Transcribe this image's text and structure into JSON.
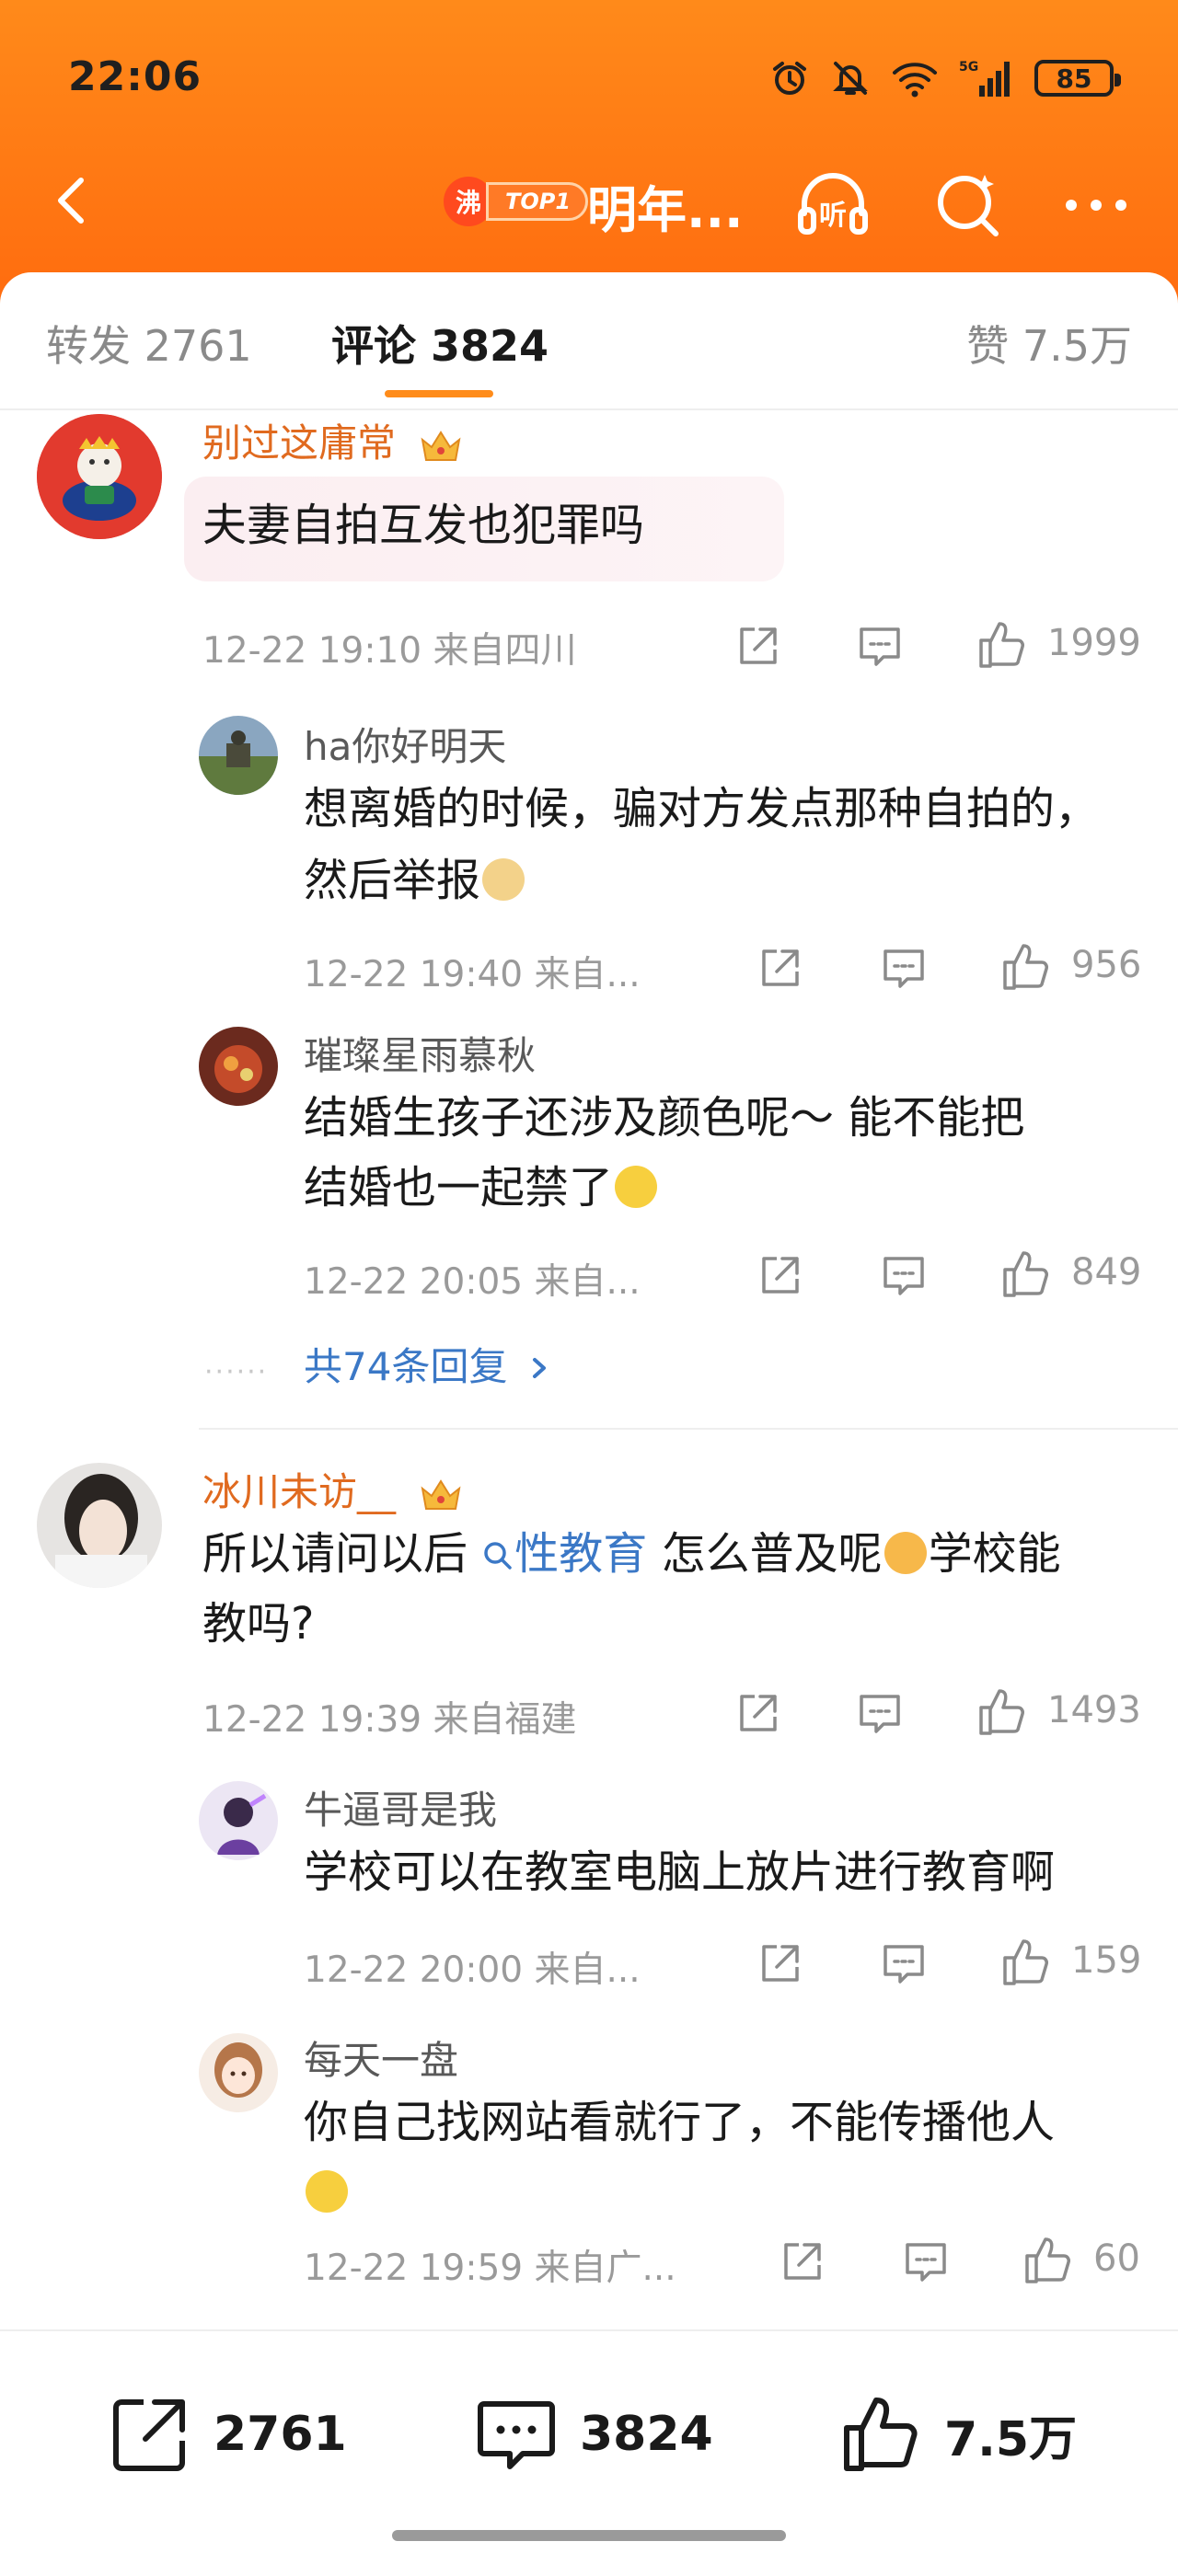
{
  "status_bar": {
    "time": "22:06",
    "battery": "85",
    "icons": [
      "alarm-icon",
      "mute-icon",
      "wifi-icon",
      "signal-5g-icon"
    ]
  },
  "header": {
    "badge_fei": "沸",
    "badge_top": "TOP1",
    "title": "明年...",
    "icons": [
      "back-icon",
      "listen-icon",
      "search-icon",
      "more-icon"
    ]
  },
  "tabs": {
    "repost": "转发 2761",
    "comment": "评论 3824",
    "like": "赞 7.5万"
  },
  "comments": [
    {
      "username": "别过这庸常",
      "text": "夫妻自拍互发也犯罪吗",
      "meta": "12-22 19:10 来自四川",
      "likes": "1999",
      "replies": [
        {
          "username": "ha你好明天",
          "text_line1": "想离婚的时候，骗对方发点那种自拍的，",
          "text_line2": "然后举报",
          "meta": "12-22 19:40 来自...",
          "likes": "956"
        },
        {
          "username": "璀璨星雨慕秋",
          "text_line1": "结婚生孩子还涉及颜色呢～ 能不能把",
          "text_line2": "结婚也一起禁了",
          "meta": "12-22 20:05 来自...",
          "likes": "849"
        }
      ],
      "more_replies": "共74条回复"
    },
    {
      "username": "冰川未访__",
      "text_prefix": "所以请问以后",
      "topic": "性教育",
      "text_mid": "怎么普及呢",
      "text_suffix": "学校能",
      "text_line2": "教吗?",
      "meta": "12-22 19:39 来自福建",
      "likes": "1493",
      "replies": [
        {
          "username": "牛逼哥是我",
          "text_line1": "学校可以在教室电脑上放片进行教育啊",
          "meta": "12-22 20:00 来自...",
          "likes": "159"
        },
        {
          "username": "每天一盘",
          "text_line1": "你自己找网站看就行了，不能传播他人",
          "meta": "12-22 19:59 来自广...",
          "likes": "60"
        }
      ]
    }
  ],
  "bottom_bar": {
    "share_count": "2761",
    "comment_count": "3824",
    "like_count": "7.5万"
  },
  "colors": {
    "header_orange": "#ff7a1a",
    "username_orange": "#e06a1f",
    "link_blue": "#3b78c6",
    "tab_underline": "#ff8c1a"
  }
}
